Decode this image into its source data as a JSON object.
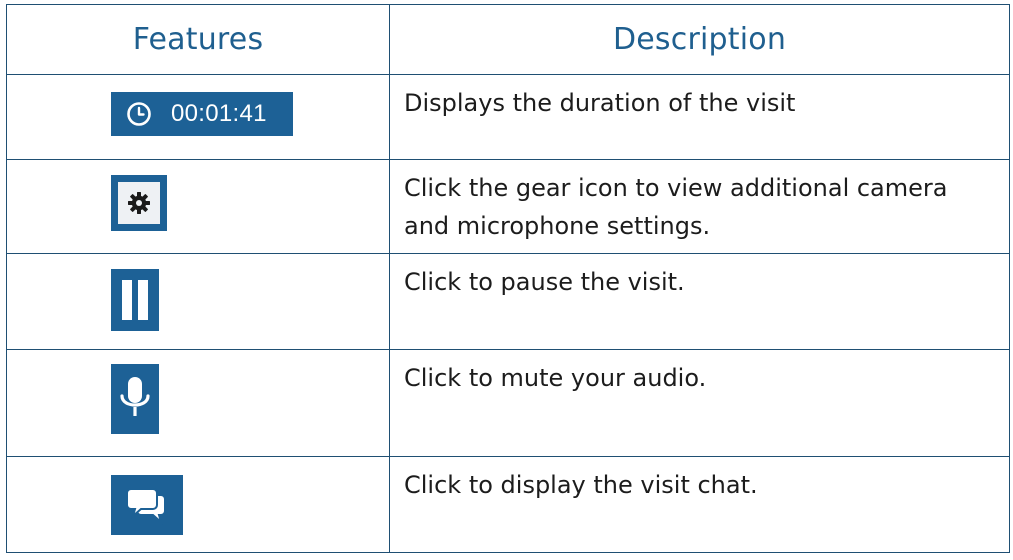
{
  "table": {
    "headers": {
      "features": "Features",
      "description": "Description"
    },
    "rows": [
      {
        "feature_icon": "clock-icon",
        "feature_text": "00:01:41",
        "description": "Displays the duration of the visit"
      },
      {
        "feature_icon": "gear-icon",
        "description": "Click the gear icon to view additional camera and microphone settings."
      },
      {
        "feature_icon": "pause-icon",
        "description": "Click to pause the visit."
      },
      {
        "feature_icon": "microphone-icon",
        "description": "Click to mute your audio."
      },
      {
        "feature_icon": "chat-bubbles-icon",
        "description": "Click to display the visit chat."
      }
    ]
  },
  "colors": {
    "border": "#1f4f73",
    "header_text": "#1f5f8f",
    "button_blue": "#1d6196",
    "body_text": "#1c1c1c"
  }
}
